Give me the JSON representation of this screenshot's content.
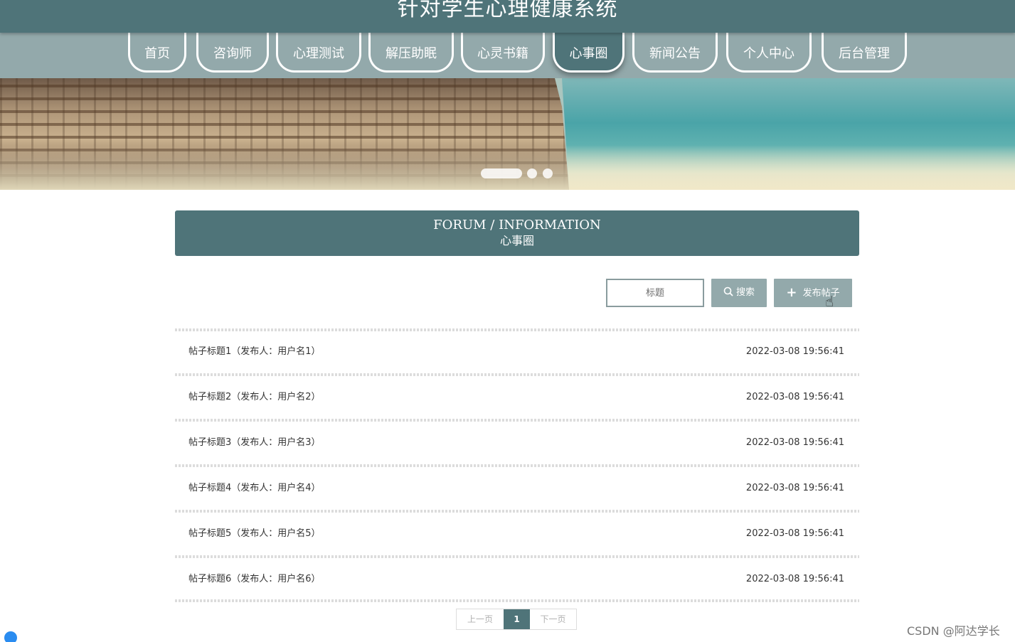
{
  "header": {
    "title": "针对学生心理健康系统"
  },
  "nav": {
    "items": [
      {
        "label": "首页"
      },
      {
        "label": "咨询师"
      },
      {
        "label": "心理测试"
      },
      {
        "label": "解压助眠"
      },
      {
        "label": "心灵书籍"
      },
      {
        "label": "心事圈"
      },
      {
        "label": "新闻公告"
      },
      {
        "label": "个人中心"
      },
      {
        "label": "后台管理"
      }
    ],
    "active": "心事圈"
  },
  "banner": {
    "slides": 3,
    "current_slide": 1
  },
  "section": {
    "title_en": "FORUM / INFORMATION",
    "title_cn": "心事圈"
  },
  "search": {
    "placeholder": "标题",
    "search_label": "搜索",
    "search_icon": "search-icon",
    "publish_label": "发布帖子",
    "publish_icon": "plus-icon"
  },
  "posts": [
    {
      "title": "帖子标题1（发布人：用户名1）",
      "time": "2022-03-08 19:56:41"
    },
    {
      "title": "帖子标题2（发布人：用户名2）",
      "time": "2022-03-08 19:56:41"
    },
    {
      "title": "帖子标题3（发布人：用户名3）",
      "time": "2022-03-08 19:56:41"
    },
    {
      "title": "帖子标题4（发布人：用户名4）",
      "time": "2022-03-08 19:56:41"
    },
    {
      "title": "帖子标题5（发布人：用户名5）",
      "time": "2022-03-08 19:56:41"
    },
    {
      "title": "帖子标题6（发布人：用户名6）",
      "time": "2022-03-08 19:56:41"
    }
  ],
  "pagination": {
    "prev": "上一页",
    "current": "1",
    "next": "下一页"
  },
  "watermark": "CSDN @阿达学长",
  "colors": {
    "primary": "#4f7479",
    "nav_bg": "#93a9ab",
    "button": "#93a9ab"
  }
}
